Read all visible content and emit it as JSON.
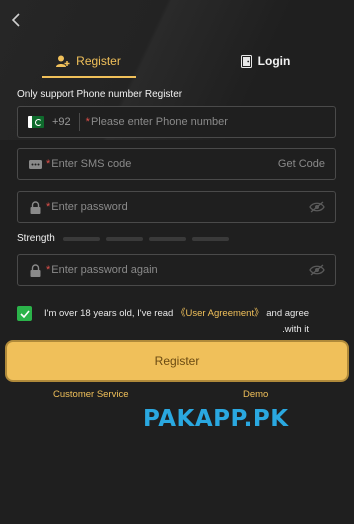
{
  "tabs": [
    {
      "label": "Register",
      "icon": "user-plus-icon",
      "active": true
    },
    {
      "label": "Login",
      "icon": "door-icon",
      "active": false
    }
  ],
  "note": "Only support Phone number Register",
  "phone": {
    "country_code": "+92",
    "placeholder": "Please enter Phone number"
  },
  "sms": {
    "placeholder": "Enter SMS code",
    "action": "Get Code"
  },
  "password": {
    "placeholder": "Enter password"
  },
  "strength": {
    "label": "Strength"
  },
  "confirm_password": {
    "placeholder": "Enter password again"
  },
  "agreement": {
    "prefix": "I'm over 18 years old, I've read",
    "link": "《User Agreement》",
    "suffix": "and agree",
    "line2": ".with it",
    "checked": true
  },
  "submit_label": "Register",
  "footer": {
    "customer_service": "Customer Service",
    "demo": "Demo"
  },
  "watermark": "PAKAPP.PK",
  "colors": {
    "accent": "#f0c05a",
    "background": "#1f1f1f",
    "check": "#2bb34a",
    "required": "#e0504a",
    "watermark": "#2aa8e0"
  }
}
